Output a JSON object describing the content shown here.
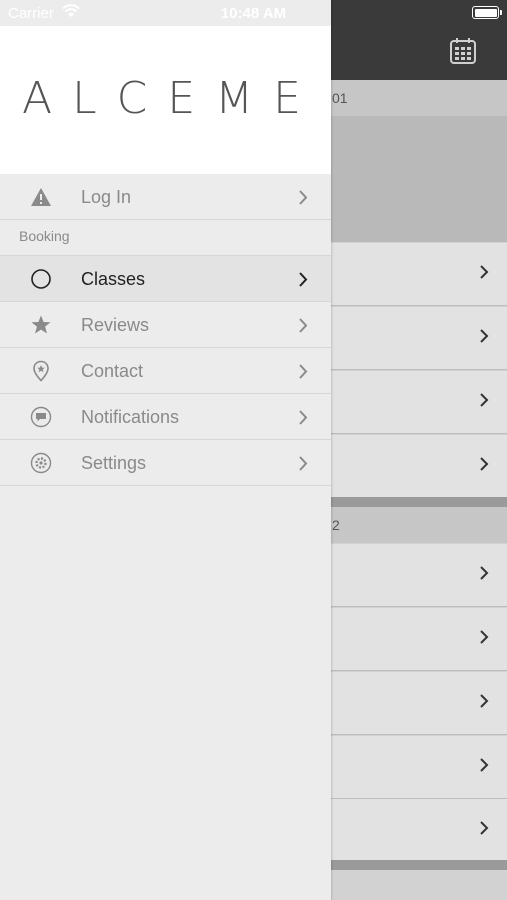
{
  "status_bar": {
    "carrier": "Carrier",
    "time": "10:48 AM"
  },
  "background": {
    "header1_text": "01",
    "header2_text": "2"
  },
  "drawer": {
    "logo_text": "ALCEME",
    "login": {
      "label": "Log In",
      "icon": "warning-icon"
    },
    "section_booking": "Booking",
    "items": [
      {
        "label": "Classes",
        "icon": "circle-icon",
        "active": true
      },
      {
        "label": "Reviews",
        "icon": "star-icon",
        "active": false
      },
      {
        "label": "Contact",
        "icon": "location-pin-icon",
        "active": false
      },
      {
        "label": "Notifications",
        "icon": "chat-bubble-icon",
        "active": false
      },
      {
        "label": "Settings",
        "icon": "gear-icon",
        "active": false
      }
    ]
  },
  "colors": {
    "nav_bar": "#3a3a3a",
    "drawer_bg": "#ececec",
    "active_text": "#222222",
    "inactive_text": "#8a8a8a"
  }
}
